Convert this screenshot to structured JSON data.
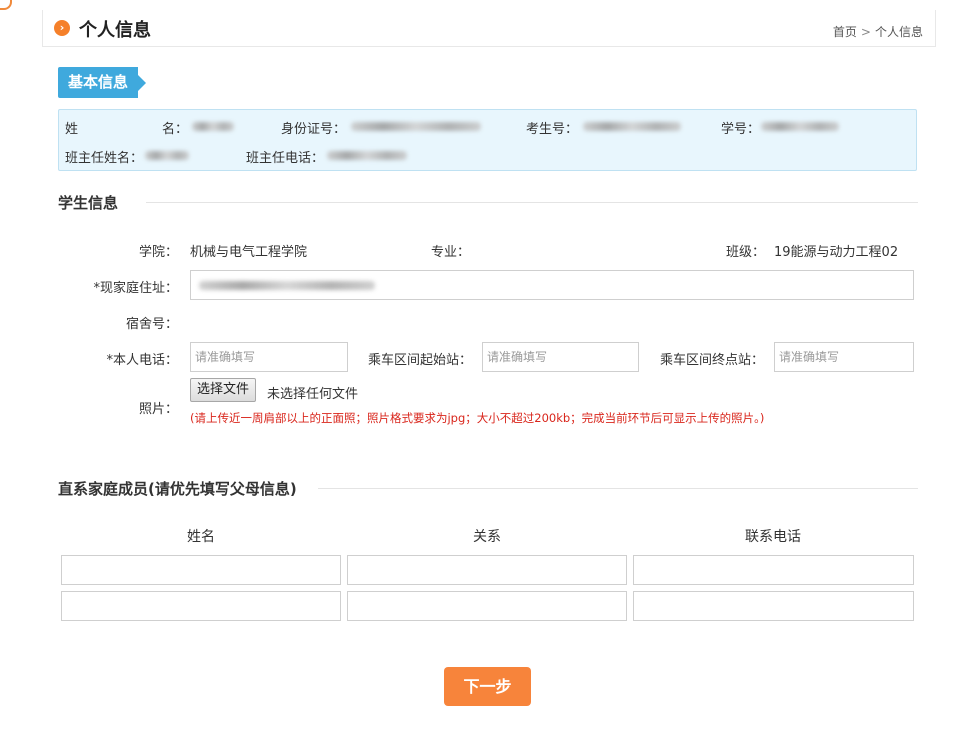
{
  "header": {
    "icon": "chevron-right-icon",
    "title": "个人信息",
    "breadcrumb": [
      "首页",
      "个人信息"
    ],
    "breadcrumb_sep": ">"
  },
  "basic_info": {
    "tag": "基本信息",
    "name_label_a": "姓",
    "name_label_b": "名：",
    "id_label": "身份证号：",
    "exam_label": "考生号：",
    "student_no_label": "学号：",
    "teacher_name_label": "班主任姓名：",
    "teacher_phone_label": "班主任电话："
  },
  "student_info": {
    "title": "学生信息",
    "college_label": "学院：",
    "college_value": "机械与电气工程学院",
    "major_label": "专业：",
    "major_value": "",
    "class_label": "班级：",
    "class_value": "19能源与动力工程02",
    "address_label": "*现家庭住址：",
    "dorm_label": "宿舍号：",
    "phone_label": "*本人电话：",
    "phone_placeholder": "请准确填写",
    "start_label": "乘车区间起始站：",
    "start_placeholder": "请准确填写",
    "end_label": "乘车区间终点站：",
    "end_placeholder": "请准确填写",
    "photo_label": "照片：",
    "file_button": "选择文件",
    "file_status": "未选择任何文件",
    "photo_hint": "(请上传近一周肩部以上的正面照；照片格式要求为jpg；大小不超过200kb；完成当前环节后可显示上传的照片。)"
  },
  "family": {
    "title": "直系家庭成员(请优先填写父母信息)",
    "columns": [
      "姓名",
      "关系",
      "联系电话"
    ],
    "rows": [
      [
        "",
        "",
        ""
      ],
      [
        "",
        "",
        ""
      ]
    ]
  },
  "next_button": "下一步",
  "colors": {
    "accent": "#f7843b",
    "info_blue": "#3fa9dd",
    "hint_red": "#d9261c"
  }
}
